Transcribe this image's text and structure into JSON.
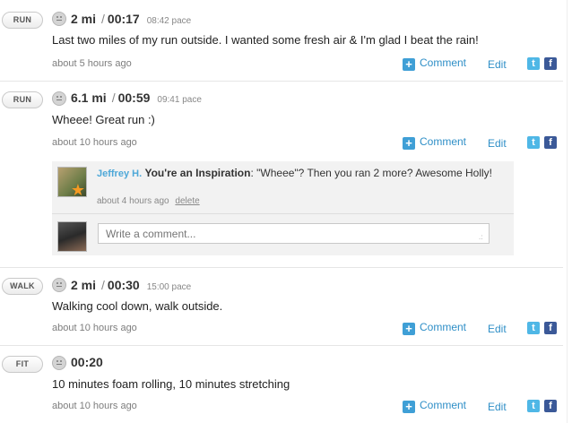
{
  "entries": [
    {
      "activity": "RUN",
      "distance": "2 mi",
      "duration": "00:17",
      "pace": "08:42 pace",
      "description": "Last two miles of my run outside. I wanted some fresh air & I'm glad I beat the rain!",
      "time_ago": "about 5 hours ago"
    },
    {
      "activity": "RUN",
      "distance": "6.1 mi",
      "duration": "00:59",
      "pace": "09:41 pace",
      "description": "Wheee! Great run :)",
      "time_ago": "about 10 hours ago",
      "comment": {
        "user": "Jeffrey H.",
        "title": "You're an Inspiration",
        "text": ": \"Wheee\"? Then you ran 2 more? Awesome Holly!",
        "time_ago": "about 4 hours ago",
        "delete_label": "delete",
        "input_placeholder": "Write a comment..."
      }
    },
    {
      "activity": "WALK",
      "distance": "2 mi",
      "duration": "00:30",
      "pace": "15:00 pace",
      "description": "Walking cool down, walk outside.",
      "time_ago": "about 10 hours ago"
    },
    {
      "activity": "FIT",
      "distance": "",
      "duration": "00:20",
      "pace": "",
      "description": "10 minutes foam rolling, 10 minutes stretching",
      "time_ago": "about 10 hours ago"
    }
  ],
  "actions": {
    "comment_label": "Comment",
    "edit_label": "Edit",
    "twitter_glyph": "t",
    "facebook_glyph": "f",
    "plus_glyph": "+"
  },
  "icons": {
    "mood": "neutral-face-icon",
    "comment": "plus-comment-icon",
    "twitter": "twitter-icon",
    "facebook": "facebook-icon"
  },
  "colors": {
    "link": "#2f8fc7",
    "twitter": "#4fb7e6",
    "facebook": "#3b5998",
    "commenter": "#4ea8d8"
  }
}
